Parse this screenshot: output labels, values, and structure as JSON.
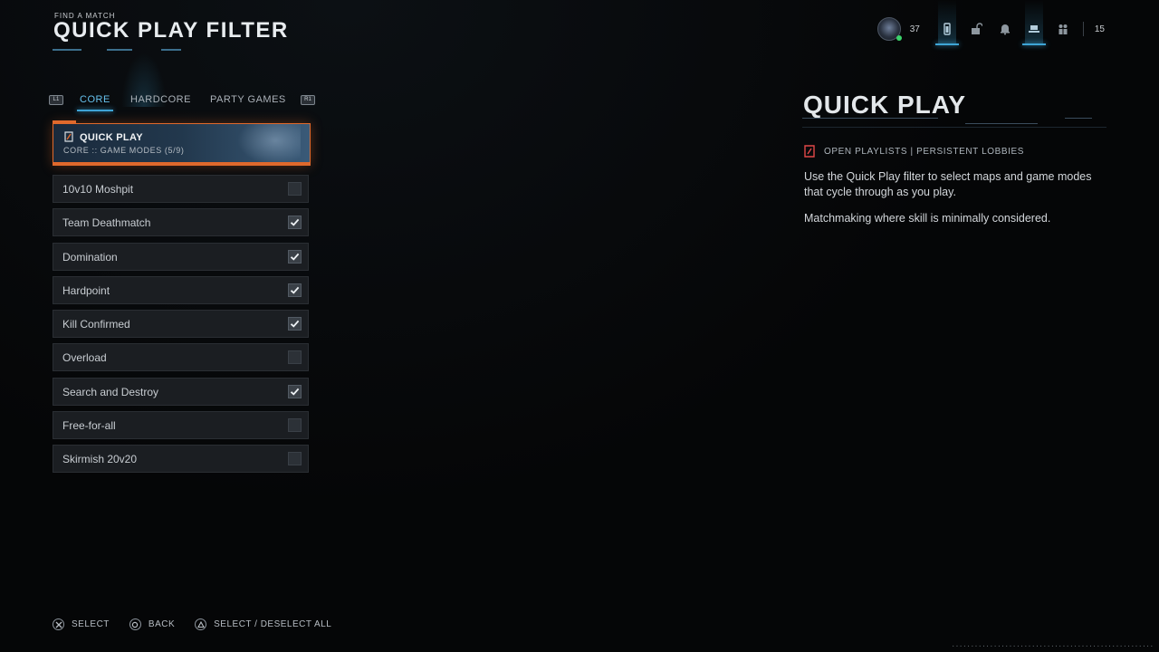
{
  "header": {
    "subtitle": "FIND A MATCH",
    "title": "QUICK PLAY FILTER"
  },
  "status_bar": {
    "player_level": "37",
    "party_count": "15",
    "icons": [
      "profile-avatar-icon",
      "battery-icon",
      "lock-icon",
      "notification-bell-icon",
      "playlist-icon",
      "social-icon"
    ]
  },
  "tabs": {
    "left_bumper": "L1",
    "right_bumper": "R1",
    "items": [
      {
        "label": "CORE",
        "active": true
      },
      {
        "label": "HARDCORE",
        "active": false
      },
      {
        "label": "PARTY GAMES",
        "active": false
      }
    ]
  },
  "playlist_card": {
    "title": "QUICK PLAY",
    "subtitle": "CORE  ::  GAME MODES (5/9)"
  },
  "modes": [
    {
      "label": "10v10 Moshpit",
      "checked": false
    },
    {
      "label": "Team Deathmatch",
      "checked": true
    },
    {
      "label": "Domination",
      "checked": true
    },
    {
      "label": "Hardpoint",
      "checked": true
    },
    {
      "label": "Kill Confirmed",
      "checked": true
    },
    {
      "label": "Overload",
      "checked": false
    },
    {
      "label": "Search and Destroy",
      "checked": true
    },
    {
      "label": "Free-for-all",
      "checked": false
    },
    {
      "label": "Skirmish 20v20",
      "checked": false
    }
  ],
  "details": {
    "title": "QUICK PLAY",
    "tags": "OPEN PLAYLISTS | PERSISTENT LOBBIES",
    "description": "Use the Quick Play filter to select maps and game modes that cycle through as you play.",
    "note": "Matchmaking where skill is minimally considered."
  },
  "footer": {
    "select": "SELECT",
    "back": "BACK",
    "select_all": "SELECT / DESELECT ALL"
  },
  "colors": {
    "accent_blue": "#3ea5d6",
    "accent_orange": "#e0692c",
    "background": "#050607"
  }
}
